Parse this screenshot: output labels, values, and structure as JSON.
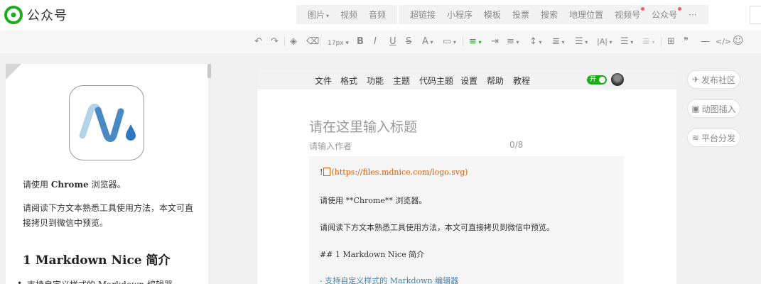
{
  "app": {
    "name": "公众号",
    "brand_color": "#1aad19"
  },
  "insert_menu": {
    "group1": [
      {
        "label": "图片",
        "caret": "▾"
      },
      {
        "label": "视频"
      },
      {
        "label": "音频"
      }
    ],
    "group2": [
      {
        "label": "超链接"
      },
      {
        "label": "小程序"
      },
      {
        "label": "模板"
      },
      {
        "label": "投票"
      },
      {
        "label": "搜索"
      },
      {
        "label": "地理位置"
      },
      {
        "label": "视频号",
        "badge": true
      },
      {
        "label": "公众号",
        "badge": true
      }
    ],
    "more": "···"
  },
  "toolbar": {
    "undo": "↶",
    "redo": "↷",
    "format_painter": "◈",
    "clear_format": "⌫",
    "font_size": "17px",
    "bold": "B",
    "italic": "I",
    "underline": "U",
    "strikethrough": "S",
    "font_color": "A",
    "bg_color": "▭",
    "align_left": "≡",
    "align_center": "≡",
    "indent": "⇥",
    "line_height": "↕",
    "paragraph_spacing": "≣",
    "list": "☰",
    "letter_spacing": "|A|",
    "table": "⊞",
    "quote": "❞",
    "hr": "—",
    "code": "</>",
    "emoji": "☺"
  },
  "preview": {
    "line1_prefix": "请使用 ",
    "line1_bold": "Chrome",
    "line1_suffix": " 浏览器。",
    "line2": "请阅读下方文本熟悉工具使用方法，本文可直接拷贝到微信中预览。",
    "heading": "1 Markdown Nice 简介",
    "list_item": "支持自定义样式的 Markdown 编辑器"
  },
  "editor_menu": [
    "文件",
    "格式",
    "功能",
    "主题",
    "代码主题",
    "设置",
    "帮助",
    "教程"
  ],
  "toggle_label": "开",
  "editor": {
    "title_placeholder": "请在这里输入标题",
    "author_placeholder": "请输入作者",
    "title_count": "0/8"
  },
  "markdown": {
    "line1_prefix": "!",
    "line1_link": "(https://files.mdnice.com/logo.svg)",
    "line2": "请使用 **Chrome** 浏览器。",
    "line3": "请阅读下方文本熟悉工具使用方法，本文可直接拷贝到微信中预览。",
    "line4": "## 1 Markdown Nice 简介",
    "line5": "- 支持自定义样式的 Markdown 编辑器"
  },
  "side_actions": [
    {
      "icon": "send-icon",
      "glyph": "✈",
      "label": "发布社区"
    },
    {
      "icon": "image-icon",
      "glyph": "▣",
      "label": "动图插入"
    },
    {
      "icon": "layers-icon",
      "glyph": "≋",
      "label": "平台分发"
    }
  ]
}
